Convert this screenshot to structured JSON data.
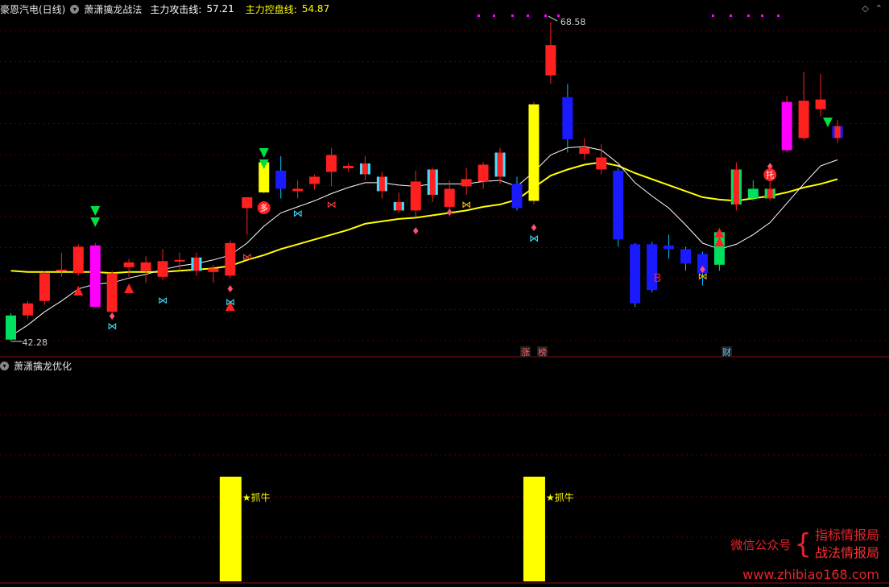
{
  "header": {
    "stock_name": "豪恩汽电(日线)",
    "indicator_name": "萧潇擒龙战法",
    "attack_line_label": "主力攻击线:",
    "attack_line_value": "57.21",
    "control_line_label": "主力控盘线:",
    "control_line_value": "54.87",
    "colors": {
      "attack": "#ffffff",
      "control": "#ffff00"
    }
  },
  "sub_header": {
    "indicator_name": "萧潇擒龙优化"
  },
  "top_right_icons": [
    "diamond-icon",
    "chevron-up-icon"
  ],
  "annotations": {
    "high_label": "68.58",
    "low_label": "42.28",
    "tag_zhang": "涨",
    "tag_bang": "榜",
    "tag_cai": "财",
    "marker_duo": "多",
    "marker_tuo": "托",
    "marker_b": "B"
  },
  "watermark": {
    "label": "微信公众号",
    "line1": "指标情报局",
    "line2": "战法情报局",
    "url": "www.zhibiao168.com"
  },
  "chart_data": [
    {
      "type": "candlestick",
      "panel": "main",
      "price_range": [
        40,
        70
      ],
      "candles": [
        {
          "o": 42.3,
          "h": 44.5,
          "l": 42.2,
          "c": 44.3,
          "color": "green"
        },
        {
          "o": 44.3,
          "h": 45.5,
          "l": 44.0,
          "c": 45.3,
          "color": "red"
        },
        {
          "o": 45.5,
          "h": 48.0,
          "l": 45.2,
          "c": 47.8,
          "color": "red"
        },
        {
          "o": 48.0,
          "h": 49.5,
          "l": 47.5,
          "c": 48.1,
          "color": "red"
        },
        {
          "o": 47.8,
          "h": 50.2,
          "l": 47.6,
          "c": 50.0,
          "color": "red"
        },
        {
          "o": 50.1,
          "h": 50.3,
          "l": 45.0,
          "c": 45.0,
          "color": "magenta"
        },
        {
          "o": 47.8,
          "h": 48.0,
          "l": 44.5,
          "c": 44.6,
          "color": "red"
        },
        {
          "o": 48.3,
          "h": 49.0,
          "l": 47.5,
          "c": 48.7,
          "color": "red"
        },
        {
          "o": 48.0,
          "h": 49.2,
          "l": 47.0,
          "c": 48.7,
          "color": "red"
        },
        {
          "o": 47.5,
          "h": 49.8,
          "l": 47.2,
          "c": 48.8,
          "color": "red"
        },
        {
          "o": 48.8,
          "h": 49.5,
          "l": 48.0,
          "c": 48.9,
          "color": "red"
        },
        {
          "o": 48.0,
          "h": 49.5,
          "l": 47.6,
          "c": 49.1,
          "color": "cyanred"
        },
        {
          "o": 47.9,
          "h": 48.5,
          "l": 47.0,
          "c": 48.2,
          "color": "red"
        },
        {
          "o": 47.6,
          "h": 50.5,
          "l": 47.4,
          "c": 50.3,
          "color": "red"
        },
        {
          "o": 53.2,
          "h": 54.0,
          "l": 51.0,
          "c": 54.1,
          "color": "red"
        },
        {
          "o": 54.5,
          "h": 57.2,
          "l": 54.4,
          "c": 57.0,
          "color": "yellow"
        },
        {
          "o": 56.3,
          "h": 57.5,
          "l": 54.0,
          "c": 54.8,
          "color": "blue"
        },
        {
          "o": 54.8,
          "h": 55.5,
          "l": 54.0,
          "c": 54.6,
          "color": "red"
        },
        {
          "o": 55.2,
          "h": 56.0,
          "l": 54.7,
          "c": 55.8,
          "color": "red"
        },
        {
          "o": 56.2,
          "h": 58.2,
          "l": 55.0,
          "c": 57.6,
          "color": "red"
        },
        {
          "o": 56.5,
          "h": 56.9,
          "l": 56.2,
          "c": 56.7,
          "color": "red"
        },
        {
          "o": 56.0,
          "h": 57.5,
          "l": 55.5,
          "c": 56.9,
          "color": "cyanred"
        },
        {
          "o": 55.8,
          "h": 56.2,
          "l": 54.0,
          "c": 54.6,
          "color": "cyanred"
        },
        {
          "o": 53.7,
          "h": 54.5,
          "l": 52.8,
          "c": 53.0,
          "color": "cyanred"
        },
        {
          "o": 53.0,
          "h": 56.3,
          "l": 52.5,
          "c": 55.4,
          "color": "red"
        },
        {
          "o": 54.3,
          "h": 56.5,
          "l": 53.7,
          "c": 56.4,
          "color": "cyanred"
        },
        {
          "o": 53.3,
          "h": 55.5,
          "l": 52.7,
          "c": 54.8,
          "color": "red"
        },
        {
          "o": 55.0,
          "h": 56.5,
          "l": 54.3,
          "c": 55.6,
          "color": "red"
        },
        {
          "o": 55.4,
          "h": 57.0,
          "l": 54.8,
          "c": 56.8,
          "color": "red"
        },
        {
          "o": 55.8,
          "h": 58.2,
          "l": 55.2,
          "c": 57.8,
          "color": "cyanred"
        },
        {
          "o": 55.2,
          "h": 55.8,
          "l": 53.0,
          "c": 53.2,
          "color": "blue"
        },
        {
          "o": 53.8,
          "h": 62.0,
          "l": 53.5,
          "c": 61.8,
          "color": "yellow"
        },
        {
          "o": 64.2,
          "h": 68.6,
          "l": 63.5,
          "c": 66.7,
          "color": "red"
        },
        {
          "o": 62.4,
          "h": 63.5,
          "l": 57.8,
          "c": 58.9,
          "color": "blue"
        },
        {
          "o": 58.2,
          "h": 59.0,
          "l": 57.2,
          "c": 57.7,
          "color": "red"
        },
        {
          "o": 56.4,
          "h": 58.5,
          "l": 56.0,
          "c": 57.4,
          "color": "red"
        },
        {
          "o": 56.3,
          "h": 56.5,
          "l": 50.0,
          "c": 50.6,
          "color": "blue"
        },
        {
          "o": 50.2,
          "h": 50.3,
          "l": 45.0,
          "c": 45.3,
          "color": "blue"
        },
        {
          "o": 50.2,
          "h": 50.4,
          "l": 46.2,
          "c": 46.4,
          "color": "blue"
        },
        {
          "o": 50.1,
          "h": 51.0,
          "l": 49.0,
          "c": 49.8,
          "color": "blue"
        },
        {
          "o": 49.8,
          "h": 50.0,
          "l": 48.0,
          "c": 48.6,
          "color": "blue"
        },
        {
          "o": 49.4,
          "h": 49.6,
          "l": 46.8,
          "c": 47.8,
          "color": "blue"
        },
        {
          "o": 48.5,
          "h": 51.5,
          "l": 48.0,
          "c": 51.2,
          "color": "green"
        },
        {
          "o": 53.5,
          "h": 57.0,
          "l": 53.0,
          "c": 56.4,
          "color": "redgreen"
        },
        {
          "o": 54.0,
          "h": 55.5,
          "l": 53.8,
          "c": 54.8,
          "color": "green"
        },
        {
          "o": 54.0,
          "h": 56.0,
          "l": 53.8,
          "c": 54.8,
          "color": "redgreen"
        },
        {
          "o": 58.0,
          "h": 62.5,
          "l": 57.8,
          "c": 62.0,
          "color": "magenta"
        },
        {
          "o": 59.0,
          "h": 64.5,
          "l": 58.8,
          "c": 62.1,
          "color": "red"
        },
        {
          "o": 61.4,
          "h": 64.3,
          "l": 60.8,
          "c": 62.2,
          "color": "red"
        },
        {
          "o": 59.0,
          "h": 60.5,
          "l": 58.6,
          "c": 60.0,
          "color": "redblue"
        }
      ],
      "ma_attack_line": [
        42.6,
        43.5,
        44.6,
        45.5,
        46.5,
        46.9,
        47.0,
        47.4,
        47.7,
        48.1,
        48.4,
        48.6,
        48.9,
        49.3,
        50.3,
        51.7,
        52.8,
        53.3,
        53.8,
        54.4,
        54.9,
        55.3,
        55.3,
        55.1,
        55.0,
        55.2,
        55.2,
        55.2,
        55.4,
        55.5,
        55.0,
        56.2,
        57.6,
        58.2,
        58.3,
        58.0,
        56.9,
        55.3,
        54.2,
        53.2,
        51.8,
        50.3,
        49.8,
        50.2,
        51.0,
        52.0,
        53.6,
        55.2,
        56.7,
        57.2
      ],
      "ma_control_line": [
        48.0,
        47.9,
        47.9,
        47.9,
        47.9,
        47.9,
        47.8,
        47.9,
        47.9,
        47.9,
        48.0,
        48.1,
        48.2,
        48.4,
        48.9,
        49.3,
        49.8,
        50.2,
        50.6,
        51.0,
        51.4,
        51.9,
        52.1,
        52.3,
        52.4,
        52.6,
        52.8,
        53.0,
        53.3,
        53.5,
        53.9,
        54.9,
        55.9,
        56.4,
        56.8,
        57.0,
        56.7,
        56.1,
        55.6,
        55.1,
        54.6,
        54.1,
        53.9,
        53.8,
        54.0,
        54.2,
        54.5,
        54.9,
        55.2,
        55.6
      ],
      "signal_labels": [
        "多",
        "托",
        "B",
        "涨",
        "榜",
        "财"
      ]
    },
    {
      "type": "bar",
      "panel": "sub",
      "bars": [
        {
          "candle_index": 13,
          "label": "★抓牛",
          "color": "#ffff00"
        },
        {
          "candle_index": 31,
          "label": "★抓牛",
          "color": "#ffff00"
        }
      ]
    }
  ]
}
